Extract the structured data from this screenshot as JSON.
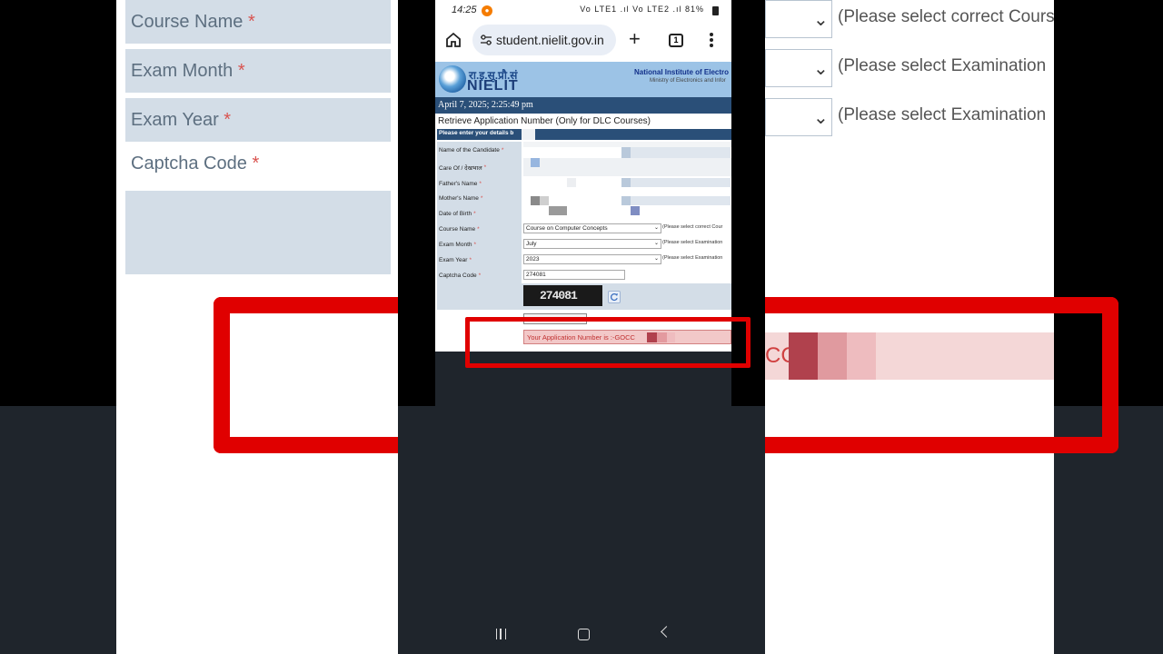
{
  "status_bar": {
    "time": "14:25",
    "icons": "Vo LTE1 .ıl Vo LTE2 .ıl",
    "battery": "81%"
  },
  "browser": {
    "url": "student.nielit.gov.in",
    "tab_count": "1"
  },
  "header": {
    "logo_hindi": "रा.इ.सू.प्रौ.सं",
    "logo_name": "NIELIT",
    "institute_name": "National Institute of Electro",
    "institute_sub": "Ministry of Electronics and Infor"
  },
  "date_line": "April 7, 2025; 2:25:49 pm",
  "page_title": "Retrieve Application Number  (Only for DLC Courses)",
  "form": {
    "heading": "Please enter your details b",
    "labels": {
      "name": "Name of the Candidate",
      "care_of": "Care Of / देखभाल",
      "father": "Father's Name",
      "mother": "Mother's Name",
      "dob": "Date of Birth",
      "course": "Course Name",
      "month": "Exam Month",
      "year": "Exam Year",
      "captcha": "Captcha Code"
    },
    "required_mark": "*",
    "course_value": "Course on Computer Concepts",
    "course_hint": "(Please select correct Cour",
    "month_value": "July",
    "month_hint": "(Please select Examination",
    "year_value": "2023",
    "year_hint": "(Please select Examination",
    "captcha_value": "274081",
    "captcha_image_text": "274081"
  },
  "result": {
    "text": "Your Application Number is :-GOCC"
  },
  "background_zoom": {
    "labels": [
      "Course Name",
      "Exam Month",
      "Exam Year",
      "Captcha Code"
    ],
    "hints": [
      "(Please select correct Cours",
      "(Please select Examination",
      "(Please select Examination"
    ],
    "result_fragment": "CC"
  },
  "colors": {
    "header_blue": "#2a4f78",
    "label_bg": "#d3dde7",
    "highlight_red": "#e00000",
    "result_bg": "#f2c8c8"
  }
}
